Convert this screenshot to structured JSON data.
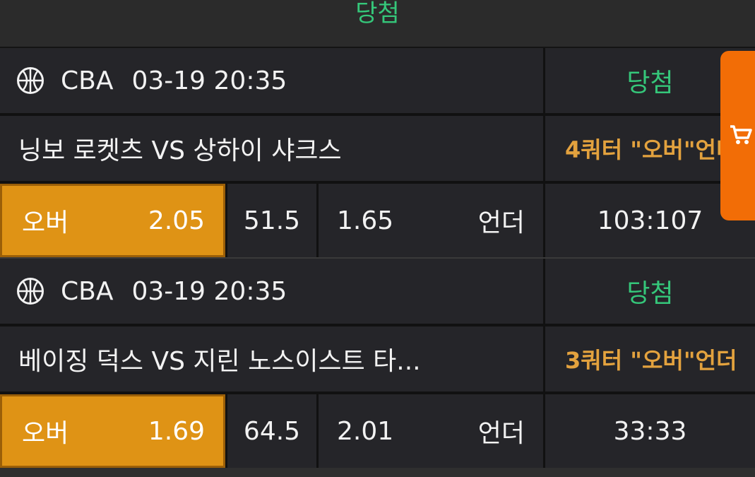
{
  "top_status": "당첨",
  "bets": [
    {
      "league": "CBA",
      "datetime": "03-19 20:35",
      "status": "당첨",
      "teams": "닝보 로켓츠 VS 상하이 샤크스",
      "market": "4쿼터 \"오버\"언더",
      "over_label": "오버",
      "over_odds": "2.05",
      "line": "51.5",
      "under_odds": "1.65",
      "under_label": "언더",
      "score": "103:107"
    },
    {
      "league": "CBA",
      "datetime": "03-19 20:35",
      "status": "당첨",
      "teams": "베이징 덕스 VS 지린 노스이스트 타...",
      "market": "3쿼터 \"오버\"언더",
      "over_label": "오버",
      "over_odds": "1.69",
      "line": "64.5",
      "under_odds": "2.01",
      "under_label": "언더",
      "score": "33:33"
    }
  ],
  "icons": {
    "sport": "basketball-icon",
    "cart": "shopping-cart-icon"
  },
  "colors": {
    "win": "#35c77a",
    "accent": "#df9315",
    "market": "#e3a23e",
    "cart_tab": "#f26d06"
  }
}
